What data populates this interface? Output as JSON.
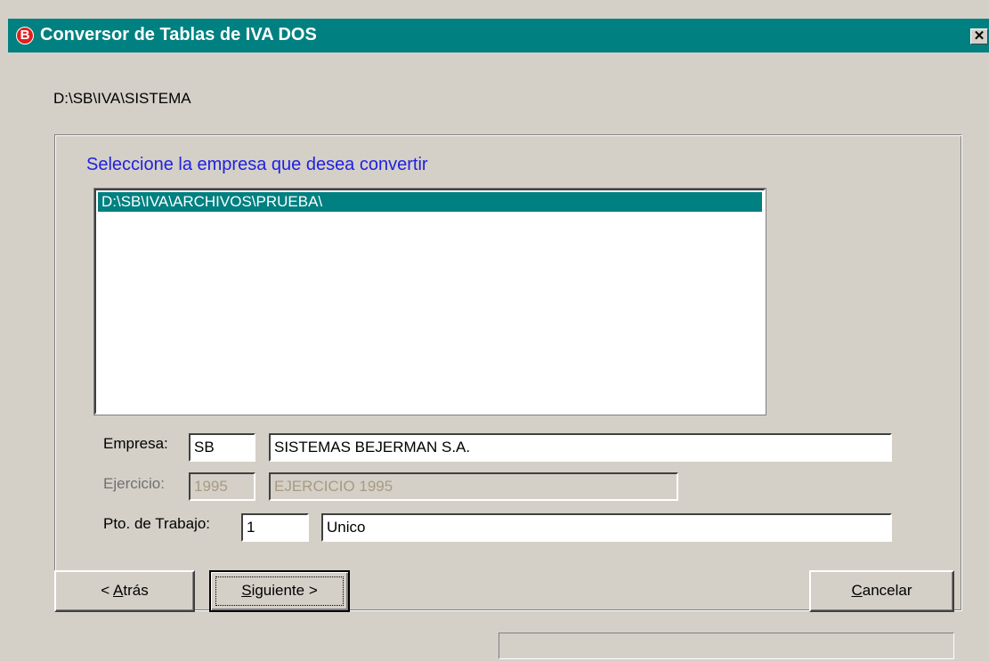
{
  "window": {
    "title": "Conversor de Tablas de IVA DOS",
    "app_icon_glyph": "B",
    "close_glyph": "✕"
  },
  "path": "D:\\SB\\IVA\\SISTEMA",
  "prompt": "Seleccione la empresa que desea convertir",
  "list": {
    "items": [
      "D:\\SB\\IVA\\ARCHIVOS\\PRUEBA\\"
    ],
    "selected_index": 0
  },
  "fields": {
    "empresa": {
      "label": "Empresa:",
      "code": "SB",
      "name": "SISTEMAS BEJERMAN S.A."
    },
    "ejercicio": {
      "label": "Ejercicio:",
      "code": "1995",
      "name": "EJERCICIO 1995"
    },
    "pto_trabajo": {
      "label": "Pto. de Trabajo:",
      "code": "1",
      "name": "Unico"
    }
  },
  "buttons": {
    "back": {
      "prefix": "< ",
      "accel": "A",
      "rest": "trás"
    },
    "next": {
      "accel": "S",
      "rest": "iguiente >"
    },
    "cancel": {
      "accel": "C",
      "rest": "ancelar"
    }
  },
  "colors": {
    "titlebar": "#008080",
    "prompt": "#2020e0",
    "selection": "#008080",
    "face": "#d4d0c8"
  },
  "icons": [
    "app-logo-icon",
    "close-icon"
  ]
}
